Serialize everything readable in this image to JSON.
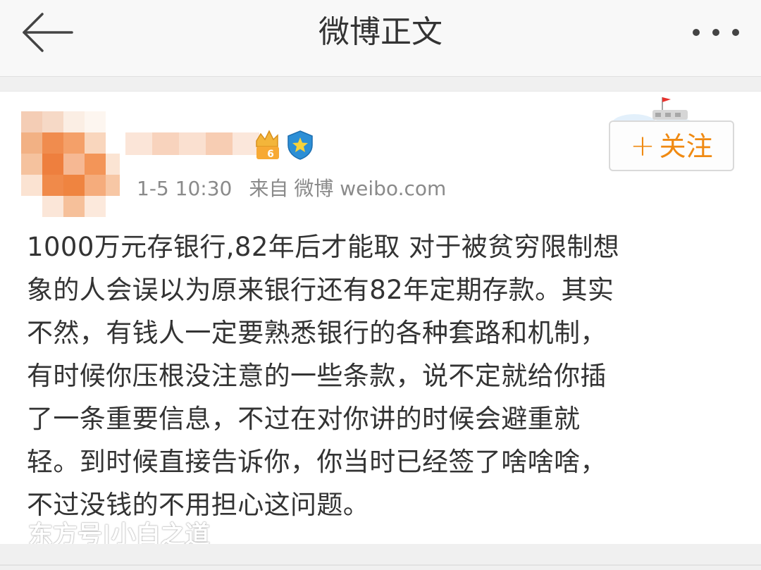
{
  "header": {
    "title": "微博正文",
    "back_icon": "arrow-left-icon",
    "more_icon": "more-dots-icon"
  },
  "post": {
    "author": {
      "avatar": "blurred-avatar",
      "name_blurred": true,
      "vip_level": "6",
      "verified_icon": "verified-star-badge-icon"
    },
    "time": "1-5 10:30",
    "source_prefix": "来自",
    "source": "微博 weibo.com",
    "follow_plus": "+",
    "follow_label": "关注",
    "follow_color": "#f08a12",
    "lines": [
      "1000万元存银行,82年后才能取  对于被贫穷限制想",
      "象的人会误以为原来银行还有82年定期存款。其实",
      "不然，有钱人一定要熟悉银行的各种套路和机制，",
      "有时候你压根没注意的一些条款，说不定就给你插",
      "了一条重要信息，不过在对你讲的时候会避重就",
      "轻。到时候直接告诉你，你当时已经签了啥啥啥，",
      "不过没钱的不用担心这问题。"
    ]
  },
  "watermark": "东方号|小白之道"
}
